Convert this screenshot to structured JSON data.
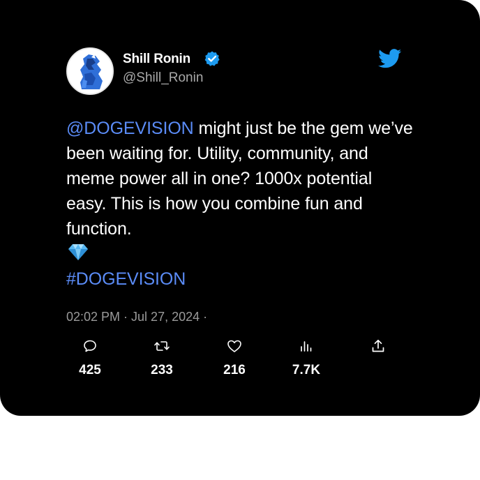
{
  "tweet": {
    "display_name": "Shill Ronin",
    "handle": "@Shill_Ronin",
    "mention": "@DOGEVISION",
    "body": " might just be the gem we’ve been waiting for. Utility, community, and meme power all in one? 1000x potential easy. This is how you combine fun and function.",
    "hashtag": "#DOGEVISION",
    "timestamp": "02:02 PM · Jul 27, 2024 ·",
    "icons": {
      "brand": "twitter-bird-icon",
      "verified": "verified-badge-icon",
      "emoji": "gem-stone-icon"
    },
    "colors": {
      "background": "#000000",
      "link": "#5b8cf7",
      "twitter_blue": "#1d9bf0",
      "muted": "#a9a9a9"
    }
  },
  "actions": {
    "reply": {
      "icon": "reply-icon",
      "count": "425"
    },
    "retweet": {
      "icon": "retweet-icon",
      "count": "233"
    },
    "like": {
      "icon": "heart-icon",
      "count": "216"
    },
    "views": {
      "icon": "views-icon",
      "count": "7.7K"
    },
    "share": {
      "icon": "share-icon"
    }
  }
}
